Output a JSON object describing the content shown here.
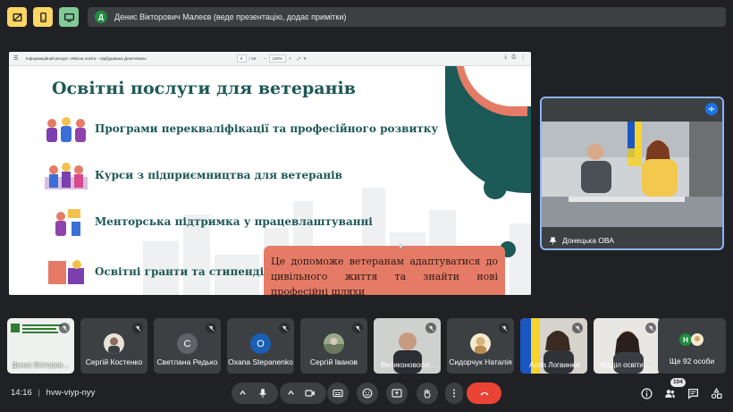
{
  "top_bar": {
    "presenter_initial": "Д",
    "presenter_text": "Денис Вікторович Малеєв (веде презентацію, додає примітки)"
  },
  "presentation": {
    "doc_title": "Інформаційний ресурс «Якісна освіта – відбудована Донеччина»",
    "page": "5",
    "pages": "/ 19",
    "zoom": "100%",
    "zoom_minus": "–",
    "zoom_plus": "+",
    "slide_title": "Освітні послуги для ветеранів",
    "items": [
      "Програми перекваліфікації та професійного розвитку",
      "Курси з підприємництва для ветеранів",
      "Менторська підтримка у працевлаштуванні",
      "Освітні гранти та стипендії"
    ],
    "callout": "Це допоможе ветеранам адаптуватися до цивільного життя та знайти нові професійні шляхи"
  },
  "video": {
    "name": "Донецька ОВА"
  },
  "participants": [
    {
      "name": "Денис Вікторович Малеєв"
    },
    {
      "name": "Сергій Костенко"
    },
    {
      "name": "Светлана Редько",
      "initial": "С",
      "color": "#5f6368"
    },
    {
      "name": "Oxana Stepanenko",
      "initial": "O",
      "color": "#1a5fb4"
    },
    {
      "name": "Сергій Іванов"
    },
    {
      "name": "Великоновосілківська"
    },
    {
      "name": "Сидорчук Наталія"
    },
    {
      "name": "Алла Логвинюк"
    },
    {
      "name": "Відділ освіти ..."
    }
  ],
  "more_tile": {
    "avatar_initial": "Н",
    "label": "Ще 92 особи"
  },
  "bottom_bar": {
    "time": "14:16",
    "separator": "|",
    "meeting_code": "hvw-viyp-nyy",
    "people_count": "104"
  },
  "icons": {
    "top_left_1": "no-stop-sign-icon",
    "top_left_2": "phone-stop-icon",
    "top_left_3": "tv-cast-icon"
  },
  "colors": {
    "background": "#202124",
    "tile": "#3c4043",
    "accent_blue": "#8ab4f8",
    "hangup_red": "#ea4335",
    "slide_teal": "#1d5956",
    "slide_orange": "#e57b66",
    "top_icon_yellow": "#fdd663",
    "top_icon_green": "#81c995"
  }
}
